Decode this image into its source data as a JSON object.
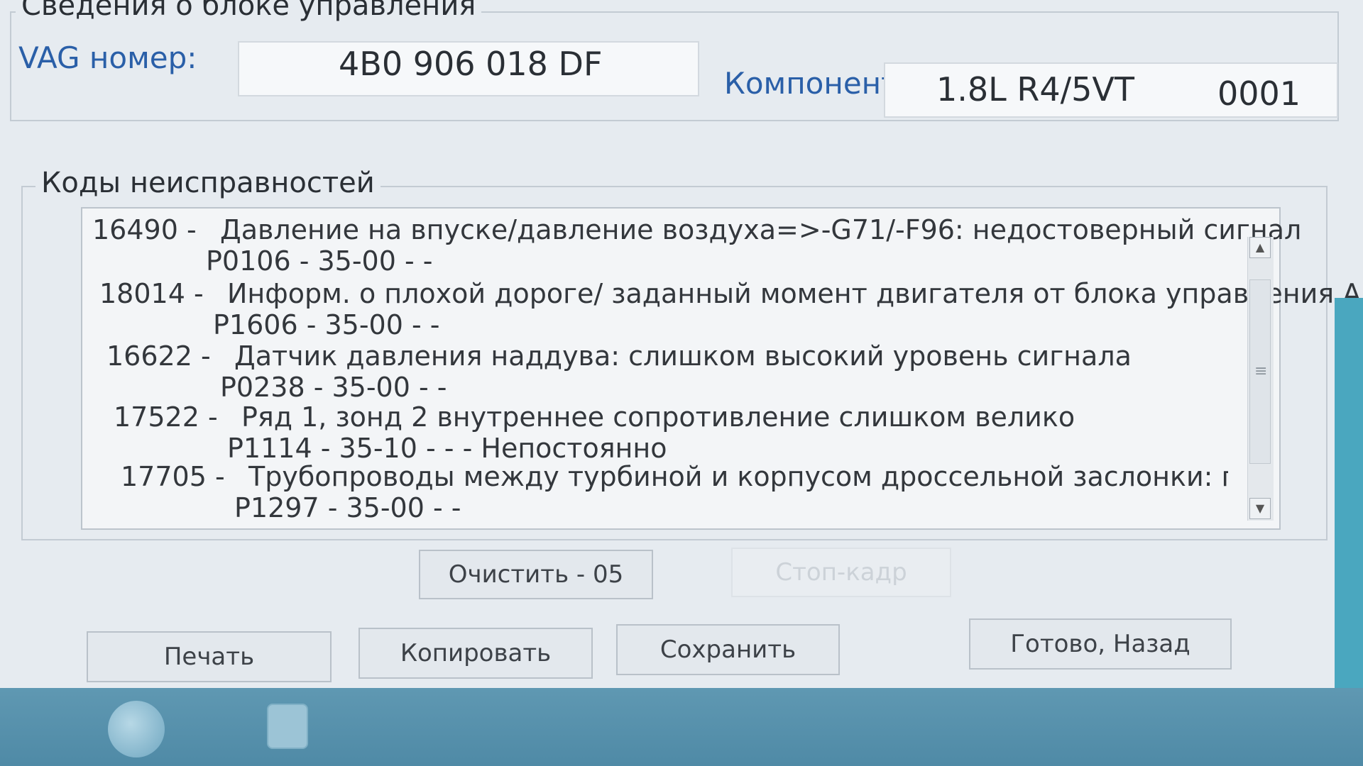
{
  "header": {
    "group_title": "Сведения о блоке управления",
    "vag_label": "VAG номер:",
    "vag_value": "4B0 906 018 DF",
    "component_label": "Компонент:",
    "component_engine": "1.8L R4/5VT",
    "component_code": "0001"
  },
  "faults": {
    "group_title": "Коды неисправностей",
    "items": [
      {
        "code": "16490 -",
        "description": "Давление на впуске/давление воздуха=>-G71/-F96: недостоверный сигнал",
        "detail": "P0106 - 35-00 -   -"
      },
      {
        "code": "18014 -",
        "description": "Информ. о плохой дороге/ заданный момент двигателя от блока управления ABS",
        "detail": "P1606 - 35-00 -   -"
      },
      {
        "code": "16622 -",
        "description": "Датчик давления наддува: слишком высокий уровень сигнала",
        "detail": "P0238 - 35-00 -   -"
      },
      {
        "code": "17522 -",
        "description": "Ряд 1, зонд 2 внутреннее сопротивление слишком велико",
        "detail": "P1114 - 35-10 -   - - Непостоянно"
      },
      {
        "code": "17705 -",
        "description": "Трубопроводы между турбиной и корпусом дроссельной заслонки: падение дав",
        "detail": "P1297 - 35-00 -   -"
      }
    ]
  },
  "buttons": {
    "clear": "Очистить - 05",
    "freeze_frame": "Стоп-кадр",
    "print": "Печать",
    "copy": "Копировать",
    "save": "Сохранить",
    "done_back": "Готово, Назад"
  },
  "icons": {
    "scroll_up": "arrow-up-icon",
    "scroll_down": "arrow-down-icon",
    "grip": "grip-icon"
  }
}
